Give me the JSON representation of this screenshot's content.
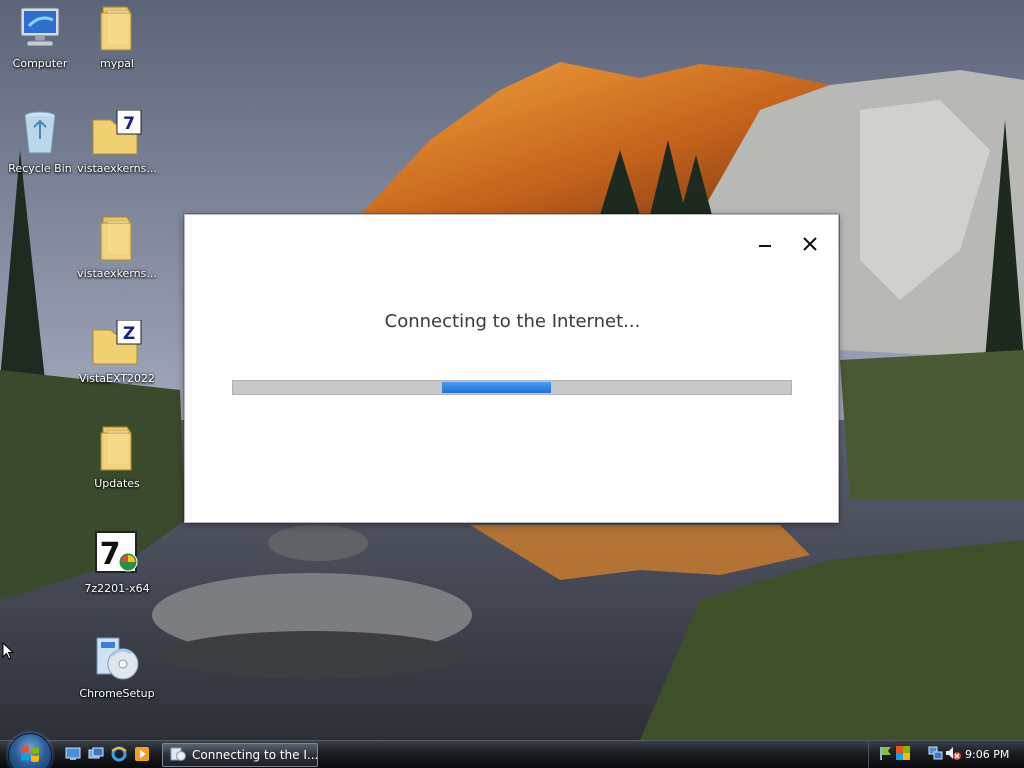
{
  "desktop": {
    "icons": [
      {
        "label": "Computer",
        "icon": "computer-icon"
      },
      {
        "label": "mypal",
        "icon": "folder-icon"
      },
      {
        "label": "Recycle Bin",
        "icon": "recycle-bin-icon"
      },
      {
        "label": "vistaexkerns...",
        "icon": "folder-7zip-icon"
      },
      {
        "label": "vistaexkerns...",
        "icon": "folder-icon"
      },
      {
        "label": "VistaEXT2022",
        "icon": "folder-zip-icon"
      },
      {
        "label": "Updates",
        "icon": "folder-icon"
      },
      {
        "label": "7z2201-x64",
        "icon": "7zip-installer-icon"
      },
      {
        "label": "ChromeSetup",
        "icon": "setup-disc-icon"
      }
    ]
  },
  "dialog": {
    "title": "Connecting to the Internet...",
    "progress": {
      "chunk_start": 0.375,
      "chunk_end": 0.57
    }
  },
  "taskbar": {
    "start_icon": "windows-start-icon",
    "quick_launch": [
      "show-desktop-icon",
      "switch-windows-icon",
      "internet-explorer-icon",
      "media-player-icon"
    ],
    "window_button_label": "Connecting to the I...",
    "clock": "9:06 PM"
  },
  "colors": {
    "progress_fill": "#1f70d8",
    "progress_track": "#c8c8c8",
    "dialog_bg": "#fdfdfd"
  }
}
